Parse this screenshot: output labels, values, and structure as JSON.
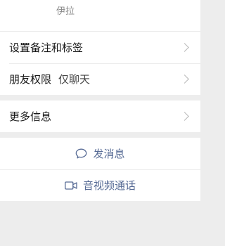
{
  "profile": {
    "name": "伊拉"
  },
  "settings": [
    {
      "label": "设置备注和标签",
      "value": ""
    },
    {
      "label": "朋友权限",
      "value": "仅聊天"
    }
  ],
  "more": {
    "label": "更多信息"
  },
  "actions": [
    {
      "label": "发消息",
      "icon": "chat-bubble-icon"
    },
    {
      "label": "音视频通话",
      "icon": "video-call-icon"
    }
  ],
  "colors": {
    "accent": "#576b95",
    "background": "#ededed",
    "chevron": "#b8b8b8"
  }
}
